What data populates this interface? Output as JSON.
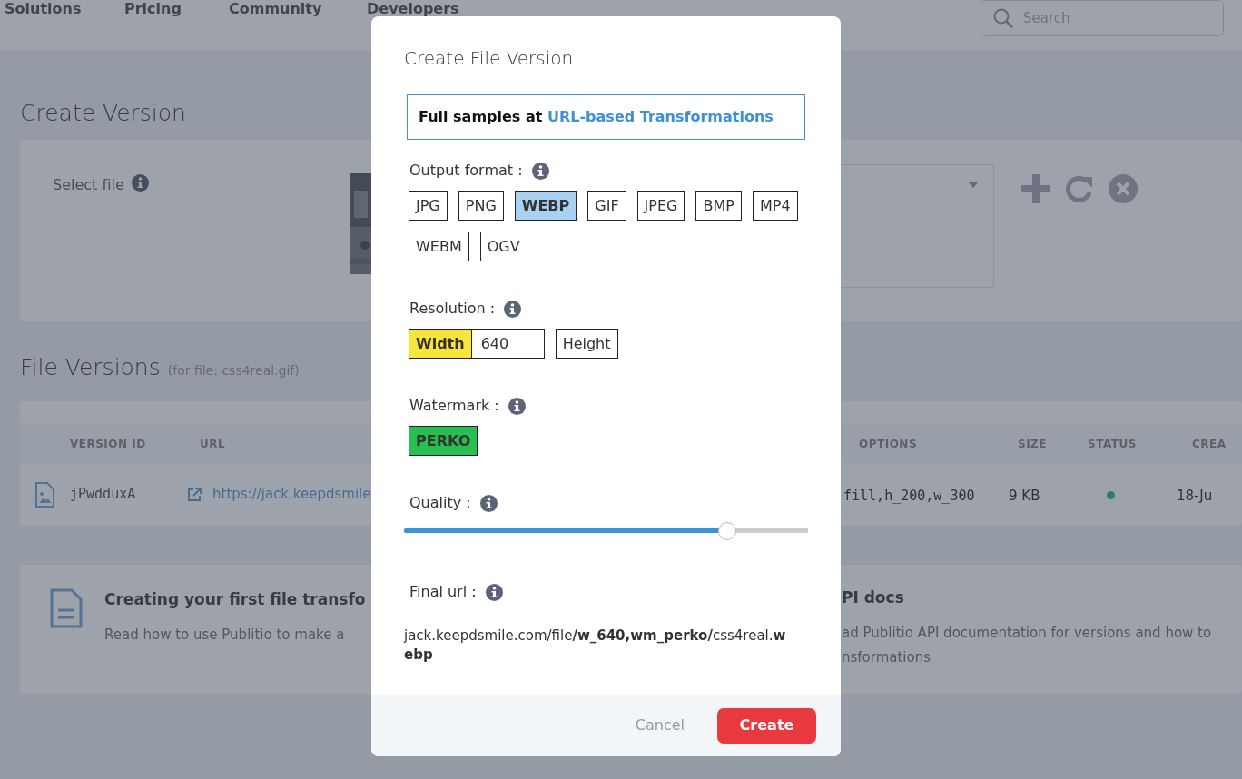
{
  "nav": {
    "items": [
      "Solutions",
      "Pricing",
      "Community",
      "Developers"
    ],
    "search_placeholder": "Search"
  },
  "create_version": {
    "title": "Create Version",
    "select_label": "Select file"
  },
  "file_versions": {
    "title": "File Versions",
    "subtitle": "(for file: css4real.gif)",
    "columns": [
      "VERSION ID",
      "URL",
      "OPTIONS",
      "SIZE",
      "STATUS",
      "CREA"
    ],
    "rows": [
      {
        "version_id": "jPwdduxA",
        "url": "https://jack.keepdsmile",
        "options": "fill,h_200,w_300",
        "size": "9 KB",
        "active": true,
        "created": "18-Ju"
      }
    ]
  },
  "help_cards": [
    {
      "title": "Creating your first file transfo",
      "lines": [
        "Read how to use Publitio to make a"
      ]
    },
    {
      "title": "PI docs",
      "lines": [
        "ad Publitio API documentation for versions and how to",
        "nsformations"
      ]
    }
  ],
  "dialog": {
    "title": "Create File Version",
    "samples": {
      "text": "Full samples at",
      "link": "URL-based Transformations"
    },
    "output_format": {
      "label": "Output format :",
      "options": [
        {
          "label": "JPG",
          "selected": false
        },
        {
          "label": "PNG",
          "selected": false
        },
        {
          "label": "WEBP",
          "selected": true
        },
        {
          "label": "GIF",
          "selected": false
        },
        {
          "label": "JPEG",
          "selected": false
        },
        {
          "label": "BMP",
          "selected": false
        },
        {
          "label": "MP4",
          "selected": false
        },
        {
          "label": "WEBM",
          "selected": false
        },
        {
          "label": "OGV",
          "selected": false
        }
      ]
    },
    "resolution": {
      "label": "Resolution :",
      "fields": [
        {
          "label": "Width",
          "selected": true,
          "value": "640"
        },
        {
          "label": "Height",
          "selected": false
        }
      ]
    },
    "watermark": {
      "label": "Watermark :",
      "options": [
        {
          "label": "PERKO",
          "selected": true
        }
      ]
    },
    "quality": {
      "label": "Quality :",
      "level": 0.8
    },
    "final_url": {
      "label": "Final url :",
      "value": "jack.keepdsmile.com/file**/w_640,wm_perko/**css4real.**webp**"
    },
    "buttons": [
      {
        "label": "Cancel",
        "kind": "secondary"
      },
      {
        "label": "Create",
        "kind": "primary"
      }
    ]
  }
}
